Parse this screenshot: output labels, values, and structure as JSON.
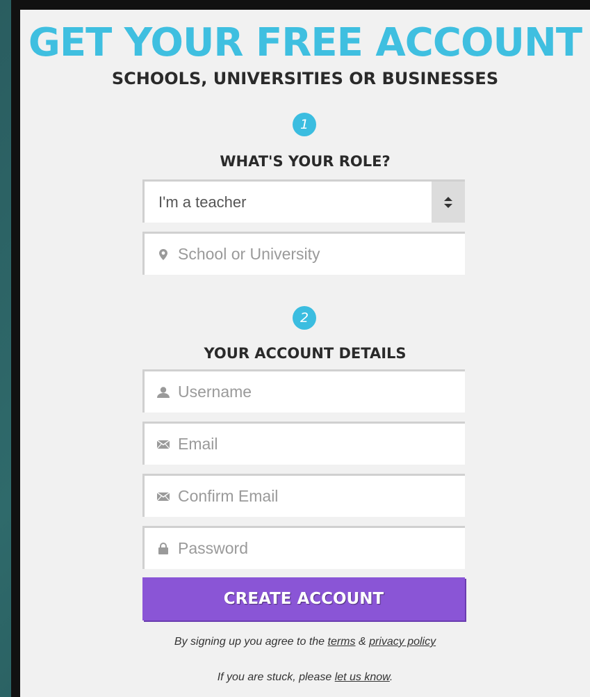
{
  "header": {
    "title": "GET YOUR FREE ACCOUNT",
    "subtitle": "SCHOOLS, UNIVERSITIES OR BUSINESSES"
  },
  "step1": {
    "number": "1",
    "heading": "WHAT'S YOUR ROLE?",
    "role_select": {
      "value": "I'm a teacher"
    },
    "school_field": {
      "placeholder": "School or University",
      "icon": "map-pin-icon"
    }
  },
  "step2": {
    "number": "2",
    "heading": "YOUR ACCOUNT DETAILS",
    "username_field": {
      "placeholder": "Username",
      "icon": "user-icon"
    },
    "email_field": {
      "placeholder": "Email",
      "icon": "envelope-icon"
    },
    "confirm_email_field": {
      "placeholder": "Confirm Email",
      "icon": "envelope-icon"
    },
    "password_field": {
      "placeholder": "Password",
      "icon": "lock-icon"
    }
  },
  "create_button": {
    "label": "CREATE ACCOUNT"
  },
  "terms": {
    "prefix": "By signing up you agree to the ",
    "terms_link": "terms",
    "amp": " & ",
    "privacy_link": "privacy policy"
  },
  "help": {
    "prefix": "If you are stuck, please ",
    "link": "let us know",
    "suffix": "."
  },
  "colors": {
    "accent": "#3fbfe0",
    "button": "#8a55d6",
    "panel": "#f1f1f1"
  }
}
